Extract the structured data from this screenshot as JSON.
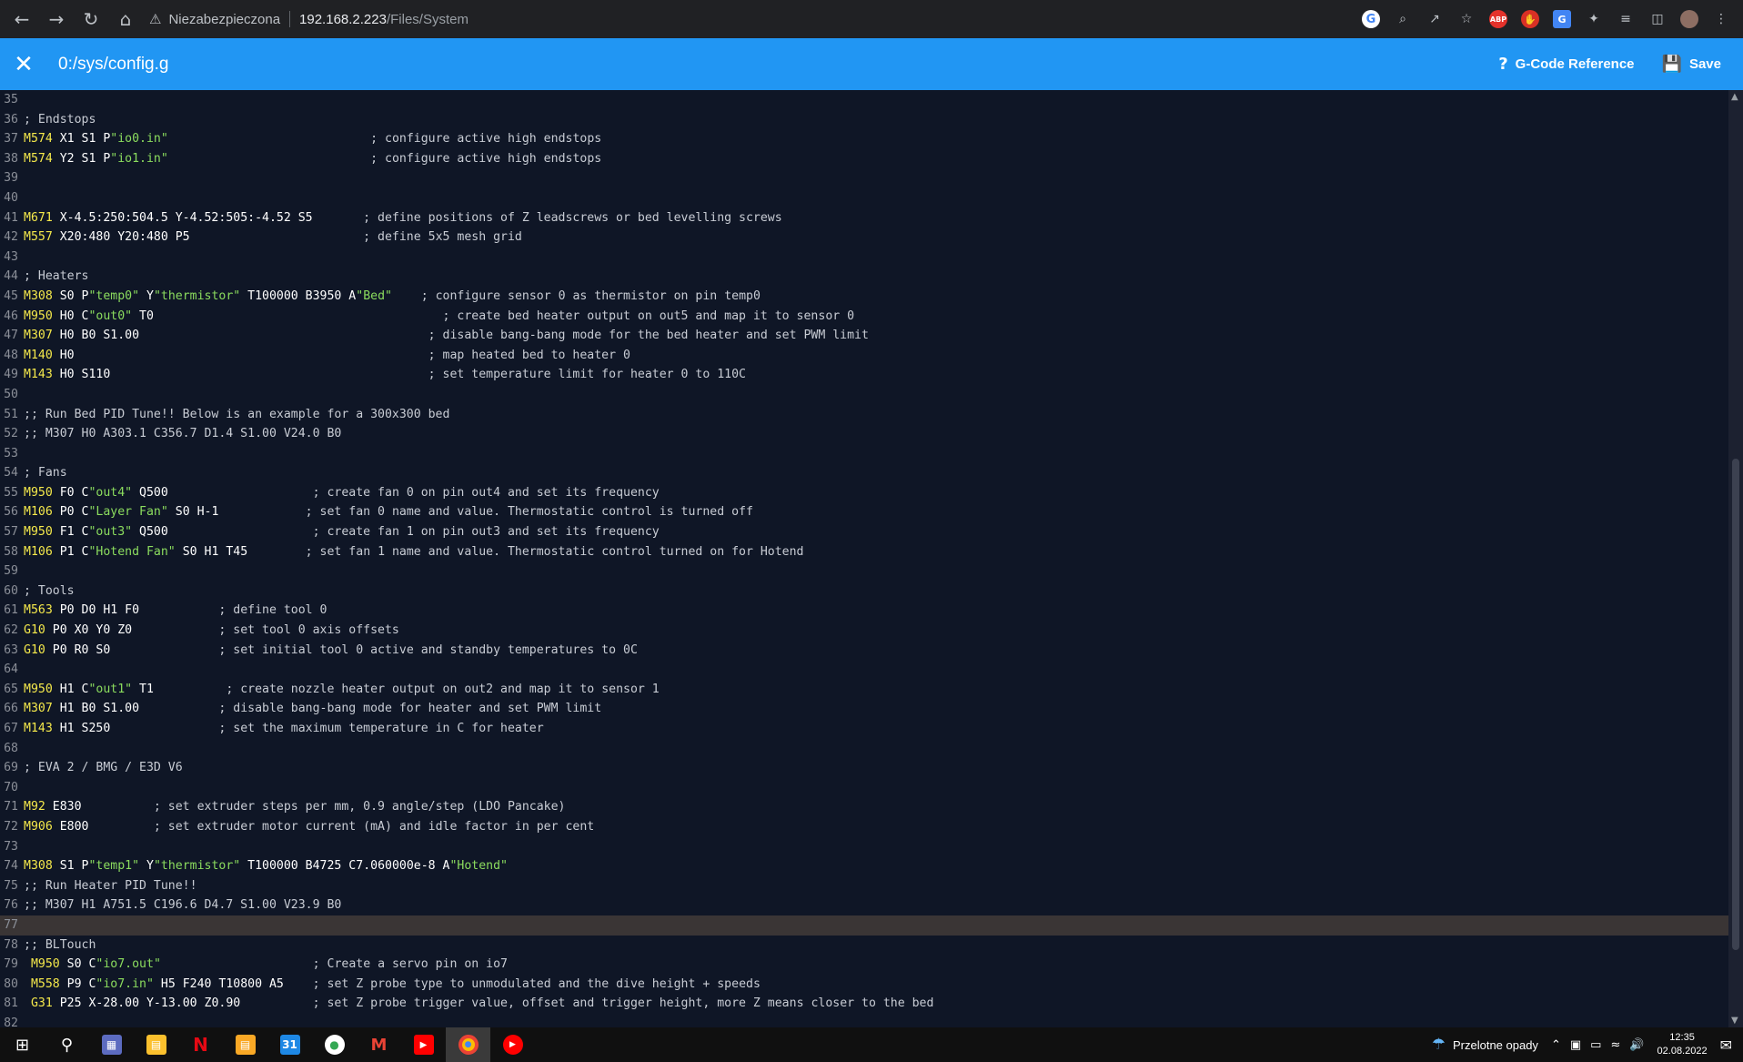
{
  "browser": {
    "security_label": "Niezabezpieczona",
    "url_host": "192.168.2.223",
    "url_path": "/Files/System"
  },
  "appbar": {
    "title": "0:/sys/config.g",
    "gcode_reference_label": "G-Code Reference",
    "save_label": "Save"
  },
  "editor": {
    "current_line": 77,
    "lines": [
      {
        "n": "35",
        "t": []
      },
      {
        "n": "36",
        "t": [
          [
            "cm",
            "; Endstops"
          ]
        ]
      },
      {
        "n": "37",
        "t": [
          [
            "kw",
            "M574"
          ],
          [
            "pl",
            " X1 S1 P"
          ],
          [
            "st",
            "\"io0.in\""
          ],
          [
            "cm",
            "                            ; configure active high endstops"
          ]
        ]
      },
      {
        "n": "38",
        "t": [
          [
            "kw",
            "M574"
          ],
          [
            "pl",
            " Y2 S1 P"
          ],
          [
            "st",
            "\"io1.in\""
          ],
          [
            "cm",
            "                            ; configure active high endstops"
          ]
        ]
      },
      {
        "n": "39",
        "t": []
      },
      {
        "n": "40",
        "t": []
      },
      {
        "n": "41",
        "t": [
          [
            "kw",
            "M671"
          ],
          [
            "pl",
            " X-4.5:250:504.5 Y-4.52:505:-4.52 S5"
          ],
          [
            "cm",
            "       ; define positions of Z leadscrews or bed levelling screws"
          ]
        ]
      },
      {
        "n": "42",
        "t": [
          [
            "kw",
            "M557"
          ],
          [
            "pl",
            " X20:480 Y20:480 P5"
          ],
          [
            "cm",
            "                        ; define 5x5 mesh grid"
          ]
        ]
      },
      {
        "n": "43",
        "t": []
      },
      {
        "n": "44",
        "t": [
          [
            "cm",
            "; Heaters"
          ]
        ]
      },
      {
        "n": "45",
        "t": [
          [
            "kw",
            "M308"
          ],
          [
            "pl",
            " S0 P"
          ],
          [
            "st",
            "\"temp0\""
          ],
          [
            "pl",
            " Y"
          ],
          [
            "st",
            "\"thermistor\""
          ],
          [
            "pl",
            " T100000 B3950 A"
          ],
          [
            "st",
            "\"Bed\""
          ],
          [
            "cm",
            "    ; configure sensor 0 as thermistor on pin temp0"
          ]
        ]
      },
      {
        "n": "46",
        "t": [
          [
            "kw",
            "M950"
          ],
          [
            "pl",
            " H0 C"
          ],
          [
            "st",
            "\"out0\""
          ],
          [
            "pl",
            " T0"
          ],
          [
            "cm",
            "                                        ; create bed heater output on out5 and map it to sensor 0"
          ]
        ]
      },
      {
        "n": "47",
        "t": [
          [
            "kw",
            "M307"
          ],
          [
            "pl",
            " H0 B0 S1.00"
          ],
          [
            "cm",
            "                                        ; disable bang-bang mode for the bed heater and set PWM limit"
          ]
        ]
      },
      {
        "n": "48",
        "t": [
          [
            "kw",
            "M140"
          ],
          [
            "pl",
            " H0"
          ],
          [
            "cm",
            "                                                 ; map heated bed to heater 0"
          ]
        ]
      },
      {
        "n": "49",
        "t": [
          [
            "kw",
            "M143"
          ],
          [
            "pl",
            " H0 S110"
          ],
          [
            "cm",
            "                                            ; set temperature limit for heater 0 to 110C"
          ]
        ]
      },
      {
        "n": "50",
        "t": []
      },
      {
        "n": "51",
        "t": [
          [
            "cm",
            ";; Run Bed PID Tune!! Below is an example for a 300x300 bed"
          ]
        ]
      },
      {
        "n": "52",
        "t": [
          [
            "cm",
            ";; M307 H0 A303.1 C356.7 D1.4 S1.00 V24.0 B0"
          ]
        ]
      },
      {
        "n": "53",
        "t": []
      },
      {
        "n": "54",
        "t": [
          [
            "cm",
            "; Fans"
          ]
        ]
      },
      {
        "n": "55",
        "t": [
          [
            "kw",
            "M950"
          ],
          [
            "pl",
            " F0 C"
          ],
          [
            "st",
            "\"out4\""
          ],
          [
            "pl",
            " Q500"
          ],
          [
            "cm",
            "                    ; create fan 0 on pin out4 and set its frequency"
          ]
        ]
      },
      {
        "n": "56",
        "t": [
          [
            "kw",
            "M106"
          ],
          [
            "pl",
            " P0 C"
          ],
          [
            "st",
            "\"Layer Fan\""
          ],
          [
            "pl",
            " S0 H-1"
          ],
          [
            "cm",
            "            ; set fan 0 name and value. Thermostatic control is turned off"
          ]
        ]
      },
      {
        "n": "57",
        "t": [
          [
            "kw",
            "M950"
          ],
          [
            "pl",
            " F1 C"
          ],
          [
            "st",
            "\"out3\""
          ],
          [
            "pl",
            " Q500"
          ],
          [
            "cm",
            "                    ; create fan 1 on pin out3 and set its frequency"
          ]
        ]
      },
      {
        "n": "58",
        "t": [
          [
            "kw",
            "M106"
          ],
          [
            "pl",
            " P1 C"
          ],
          [
            "st",
            "\"Hotend Fan\""
          ],
          [
            "pl",
            " S0 H1 T45"
          ],
          [
            "cm",
            "        ; set fan 1 name and value. Thermostatic control turned on for Hotend"
          ]
        ]
      },
      {
        "n": "59",
        "t": []
      },
      {
        "n": "60",
        "t": [
          [
            "cm",
            "; Tools"
          ]
        ]
      },
      {
        "n": "61",
        "t": [
          [
            "kw",
            "M563"
          ],
          [
            "pl",
            " P0 D0 H1 F0"
          ],
          [
            "cm",
            "           ; define tool 0"
          ]
        ]
      },
      {
        "n": "62",
        "t": [
          [
            "kw",
            "G10"
          ],
          [
            "pl",
            " P0 X0 Y0 Z0"
          ],
          [
            "cm",
            "            ; set tool 0 axis offsets"
          ]
        ]
      },
      {
        "n": "63",
        "t": [
          [
            "kw",
            "G10"
          ],
          [
            "pl",
            " P0 R0 S0"
          ],
          [
            "cm",
            "               ; set initial tool 0 active and standby temperatures to 0C"
          ]
        ]
      },
      {
        "n": "64",
        "t": []
      },
      {
        "n": "65",
        "t": [
          [
            "kw",
            "M950"
          ],
          [
            "pl",
            " H1 C"
          ],
          [
            "st",
            "\"out1\""
          ],
          [
            "pl",
            " T1"
          ],
          [
            "cm",
            "          ; create nozzle heater output on out2 and map it to sensor 1"
          ]
        ]
      },
      {
        "n": "66",
        "t": [
          [
            "kw",
            "M307"
          ],
          [
            "pl",
            " H1 B0 S1.00"
          ],
          [
            "cm",
            "           ; disable bang-bang mode for heater and set PWM limit"
          ]
        ]
      },
      {
        "n": "67",
        "t": [
          [
            "kw",
            "M143"
          ],
          [
            "pl",
            " H1 S250"
          ],
          [
            "cm",
            "               ; set the maximum temperature in C for heater"
          ]
        ]
      },
      {
        "n": "68",
        "t": []
      },
      {
        "n": "69",
        "t": [
          [
            "cm",
            "; EVA 2 / BMG / E3D V6"
          ]
        ]
      },
      {
        "n": "70",
        "t": []
      },
      {
        "n": "71",
        "t": [
          [
            "kw",
            "M92"
          ],
          [
            "pl",
            " E830"
          ],
          [
            "cm",
            "          ; set extruder steps per mm, 0.9 angle/step (LDO Pancake)"
          ]
        ]
      },
      {
        "n": "72",
        "t": [
          [
            "kw",
            "M906"
          ],
          [
            "pl",
            " E800"
          ],
          [
            "cm",
            "         ; set extruder motor current (mA) and idle factor in per cent"
          ]
        ]
      },
      {
        "n": "73",
        "t": []
      },
      {
        "n": "74",
        "t": [
          [
            "kw",
            "M308"
          ],
          [
            "pl",
            " S1 P"
          ],
          [
            "st",
            "\"temp1\""
          ],
          [
            "pl",
            " Y"
          ],
          [
            "st",
            "\"thermistor\""
          ],
          [
            "pl",
            " T100000 B4725 C7.060000e-8 A"
          ],
          [
            "st",
            "\"Hotend\""
          ]
        ]
      },
      {
        "n": "75",
        "t": [
          [
            "cm",
            ";; Run Heater PID Tune!!"
          ]
        ]
      },
      {
        "n": "76",
        "t": [
          [
            "cm",
            ";; M307 H1 A751.5 C196.6 D4.7 S1.00 V23.9 B0"
          ]
        ]
      },
      {
        "n": "77",
        "t": []
      },
      {
        "n": "78",
        "t": [
          [
            "cm",
            ";; BLTouch"
          ]
        ]
      },
      {
        "n": "79",
        "t": [
          [
            "pl",
            " "
          ],
          [
            "kw",
            "M950"
          ],
          [
            "pl",
            " S0 C"
          ],
          [
            "st",
            "\"io7.out\""
          ],
          [
            "cm",
            "                     ; Create a servo pin on io7"
          ]
        ]
      },
      {
        "n": "80",
        "t": [
          [
            "pl",
            " "
          ],
          [
            "kw",
            "M558"
          ],
          [
            "pl",
            " P9 C"
          ],
          [
            "st",
            "\"io7.in\""
          ],
          [
            "pl",
            " H5 F240 T10800 A5"
          ],
          [
            "cm",
            "    ; set Z probe type to unmodulated and the dive height + speeds"
          ]
        ]
      },
      {
        "n": "81",
        "t": [
          [
            "pl",
            " "
          ],
          [
            "kw",
            "G31"
          ],
          [
            "pl",
            " P25 X-28.00 Y-13.00 Z0.90"
          ],
          [
            "cm",
            "          ; set Z probe trigger value, offset and trigger height, more Z means closer to the bed"
          ]
        ]
      },
      {
        "n": "82",
        "t": []
      }
    ]
  },
  "taskbar": {
    "weather_label": "Przelotne opady",
    "time": "12:35",
    "date": "02.08.2022",
    "calendar_day": "31"
  },
  "colors": {
    "accent": "#2196f3",
    "editor_bg": "#0f1626",
    "keyword": "#f5e94b",
    "string": "#8bdc5e"
  }
}
